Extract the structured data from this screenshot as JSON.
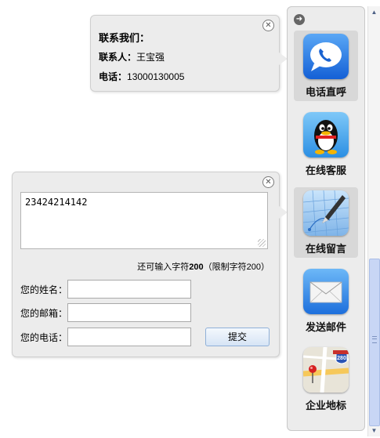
{
  "contact": {
    "title": "联系我们：",
    "person_label": "联系人：",
    "person_name": "王宝强",
    "phone_label": "电话：",
    "phone_value": "13000130005"
  },
  "message": {
    "textarea_value": "23424214142",
    "remaining_prefix": "还可输入字符",
    "remaining_count": "200",
    "limit_text": "（限制字符200）",
    "name_label": "您的姓名：",
    "email_label": "您的邮箱：",
    "phone_label": "您的电话：",
    "submit_label": "提交"
  },
  "sidebar": {
    "items": [
      {
        "label": "电话直呼",
        "icon": "phone-call-icon"
      },
      {
        "label": "在线客服",
        "icon": "qq-penguin-icon"
      },
      {
        "label": "在线留言",
        "icon": "pen-message-icon"
      },
      {
        "label": "发送邮件",
        "icon": "mail-envelope-icon"
      },
      {
        "label": "企业地标",
        "icon": "map-location-icon",
        "map_sign": "280"
      }
    ]
  },
  "colors": {
    "panel_bg": "#ececec",
    "active_item_bg": "#d8d8d8",
    "scroll_thumb": "#c8d6f5"
  }
}
